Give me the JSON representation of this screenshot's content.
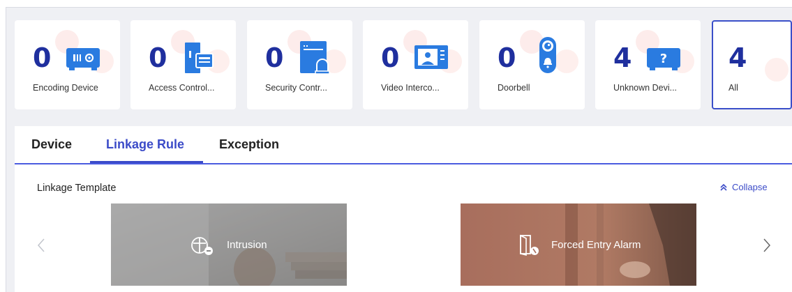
{
  "device_cards": [
    {
      "count": "0",
      "label": "Encoding Device",
      "icon": "encoding-device-icon"
    },
    {
      "count": "0",
      "label": "Access Control...",
      "icon": "access-control-icon"
    },
    {
      "count": "0",
      "label": "Security Contr...",
      "icon": "security-control-icon"
    },
    {
      "count": "0",
      "label": "Video Interco...",
      "icon": "video-intercom-icon"
    },
    {
      "count": "0",
      "label": "Doorbell",
      "icon": "doorbell-icon"
    },
    {
      "count": "4",
      "label": "Unknown Devi...",
      "icon": "unknown-device-icon"
    },
    {
      "count": "4",
      "label": "All",
      "selected": true
    }
  ],
  "tabs": [
    {
      "label": "Device"
    },
    {
      "label": "Linkage Rule",
      "active": true
    },
    {
      "label": "Exception"
    }
  ],
  "linkage": {
    "section_title": "Linkage Template",
    "collapse_label": "Collapse",
    "templates": [
      {
        "label": "Intrusion",
        "icon": "intrusion-icon"
      },
      {
        "label": "Forced Entry Alarm",
        "icon": "forced-entry-icon"
      }
    ]
  },
  "colors": {
    "accent": "#3b4bc8",
    "count_text": "#1f2f9e",
    "icon_blue": "#2a7be0",
    "card_bg": "#ffffff",
    "page_bg": "#eff0f4"
  }
}
